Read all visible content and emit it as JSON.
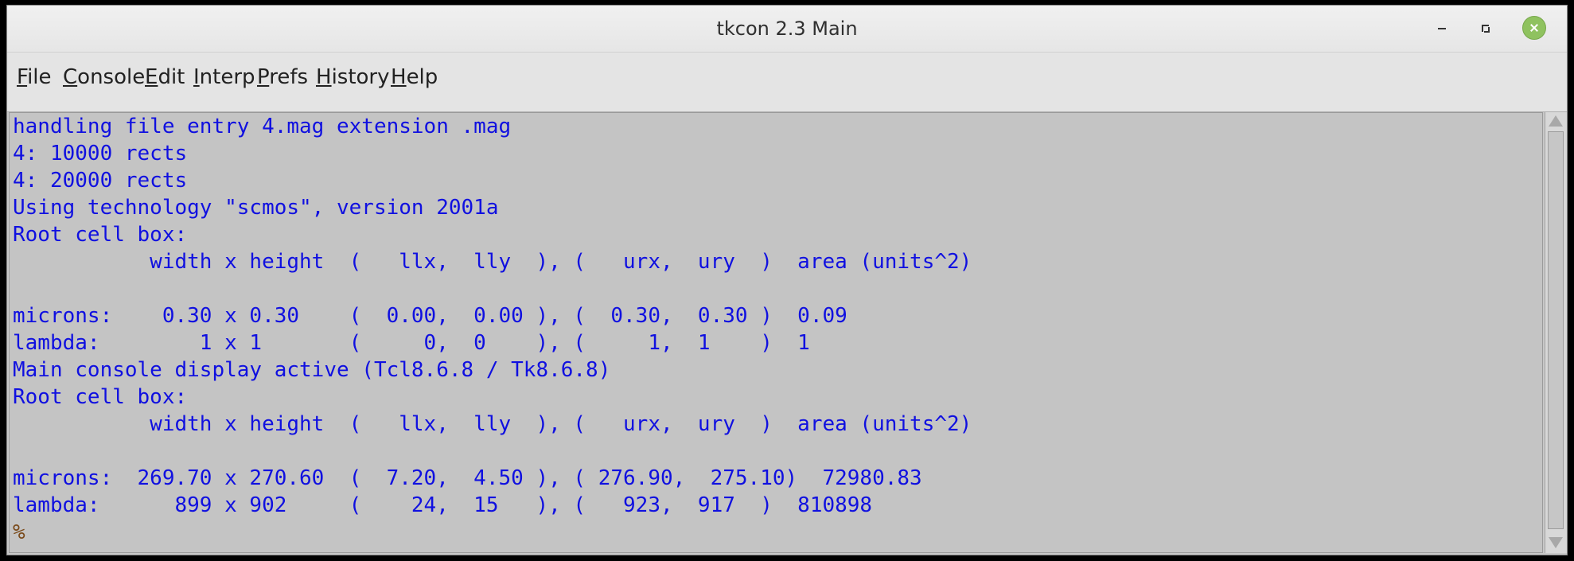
{
  "window": {
    "title": "tkcon 2.3 Main"
  },
  "menu": {
    "items": [
      {
        "label_ul": "F",
        "label_rest": "ile"
      },
      {
        "label_ul": "C",
        "label_rest": "onsole"
      },
      {
        "label_ul": "E",
        "label_rest": "dit"
      },
      {
        "label_ul": "I",
        "label_rest": "nterp"
      },
      {
        "label_ul": "P",
        "label_rest": "refs"
      },
      {
        "label_ul": "H",
        "label_rest": "istory"
      },
      {
        "label_ul": "H",
        "label_rest": "elp"
      }
    ]
  },
  "console": {
    "lines": [
      "handling file entry 4.mag extension .mag",
      "4: 10000 rects",
      "4: 20000 rects",
      "Using technology \"scmos\", version 2001a",
      "Root cell box:",
      "           width x height  (   llx,  lly  ), (   urx,  ury  )  area (units^2)",
      "",
      "microns:    0.30 x 0.30    (  0.00,  0.00 ), (  0.30,  0.30 )  0.09",
      "lambda:        1 x 1       (     0,  0    ), (     1,  1    )  1",
      "Main console display active (Tcl8.6.8 / Tk8.6.8)",
      "Root cell box:",
      "           width x height  (   llx,  lly  ), (   urx,  ury  )  area (units^2)",
      "",
      "microns:  269.70 x 270.60  (  7.20,  4.50 ), ( 276.90,  275.10)  72980.83",
      "lambda:      899 x 902     (    24,  15   ), (   923,  917  )  810898"
    ],
    "prompt": "%"
  },
  "colors": {
    "output_text": "#1010e0",
    "prompt_text": "#7a4a1a",
    "console_bg": "#c4c4c4"
  },
  "icons": [
    "minimize-icon",
    "maximize-icon",
    "close-icon",
    "scroll-up-icon",
    "scroll-down-icon"
  ]
}
